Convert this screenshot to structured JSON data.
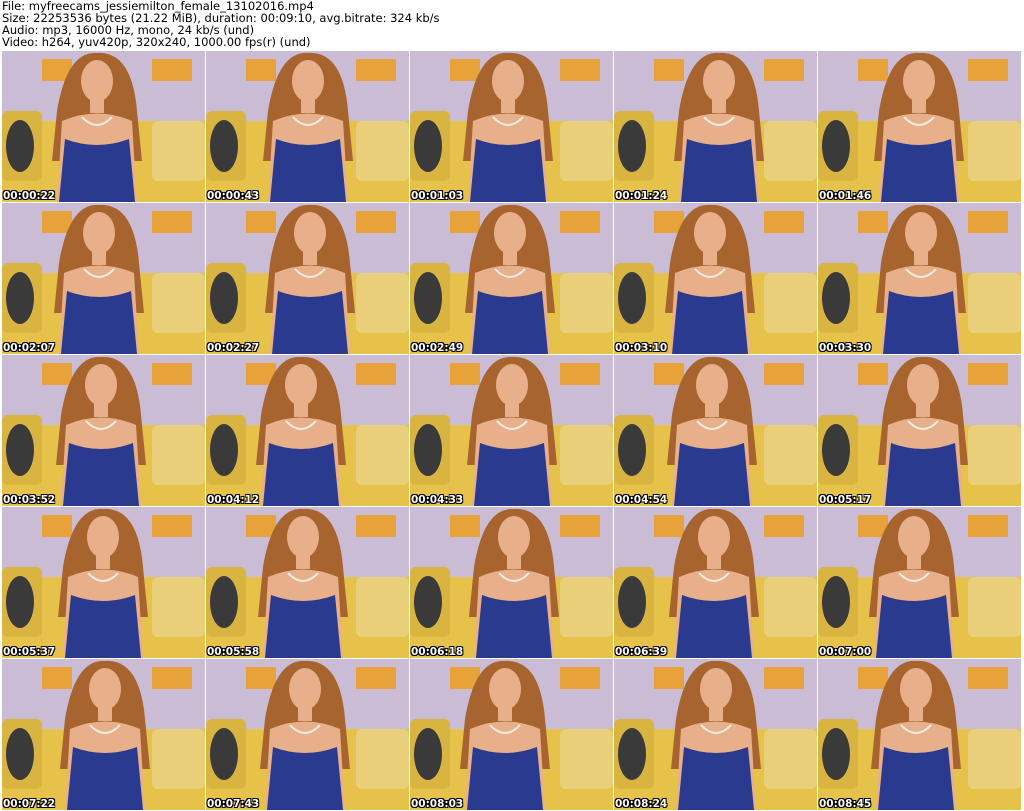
{
  "header": {
    "line1": "File: myfreecams_jessiemilton_female_13102016.mp4",
    "line2": "Size: 22253536 bytes (21.22 MiB), duration: 00:09:10, avg.bitrate: 324 kb/s",
    "line3": "Audio: mp3, 16000 Hz, mono, 24 kb/s (und)",
    "line4": "Video: h264, yuv420p, 320x240, 1000.00 fps(r) (und)"
  },
  "thumbnails": [
    {
      "time": "00:00:22"
    },
    {
      "time": "00:00:43"
    },
    {
      "time": "00:01:03"
    },
    {
      "time": "00:01:24"
    },
    {
      "time": "00:01:46"
    },
    {
      "time": "00:02:07"
    },
    {
      "time": "00:02:27"
    },
    {
      "time": "00:02:49"
    },
    {
      "time": "00:03:10"
    },
    {
      "time": "00:03:30"
    },
    {
      "time": "00:03:52"
    },
    {
      "time": "00:04:12"
    },
    {
      "time": "00:04:33"
    },
    {
      "time": "00:04:54"
    },
    {
      "time": "00:05:17"
    },
    {
      "time": "00:05:37"
    },
    {
      "time": "00:05:58"
    },
    {
      "time": "00:06:18"
    },
    {
      "time": "00:06:39"
    },
    {
      "time": "00:07:00"
    },
    {
      "time": "00:07:22"
    },
    {
      "time": "00:07:43"
    },
    {
      "time": "00:08:03"
    },
    {
      "time": "00:08:24"
    },
    {
      "time": "00:08:45"
    }
  ],
  "colors": {
    "wall": "#c9bcd4",
    "sofa": "#e6c24a",
    "frame": "#e8a23a",
    "hair": "#a8642e",
    "skin": "#e8b08a",
    "dress": "#2a3a8e"
  }
}
